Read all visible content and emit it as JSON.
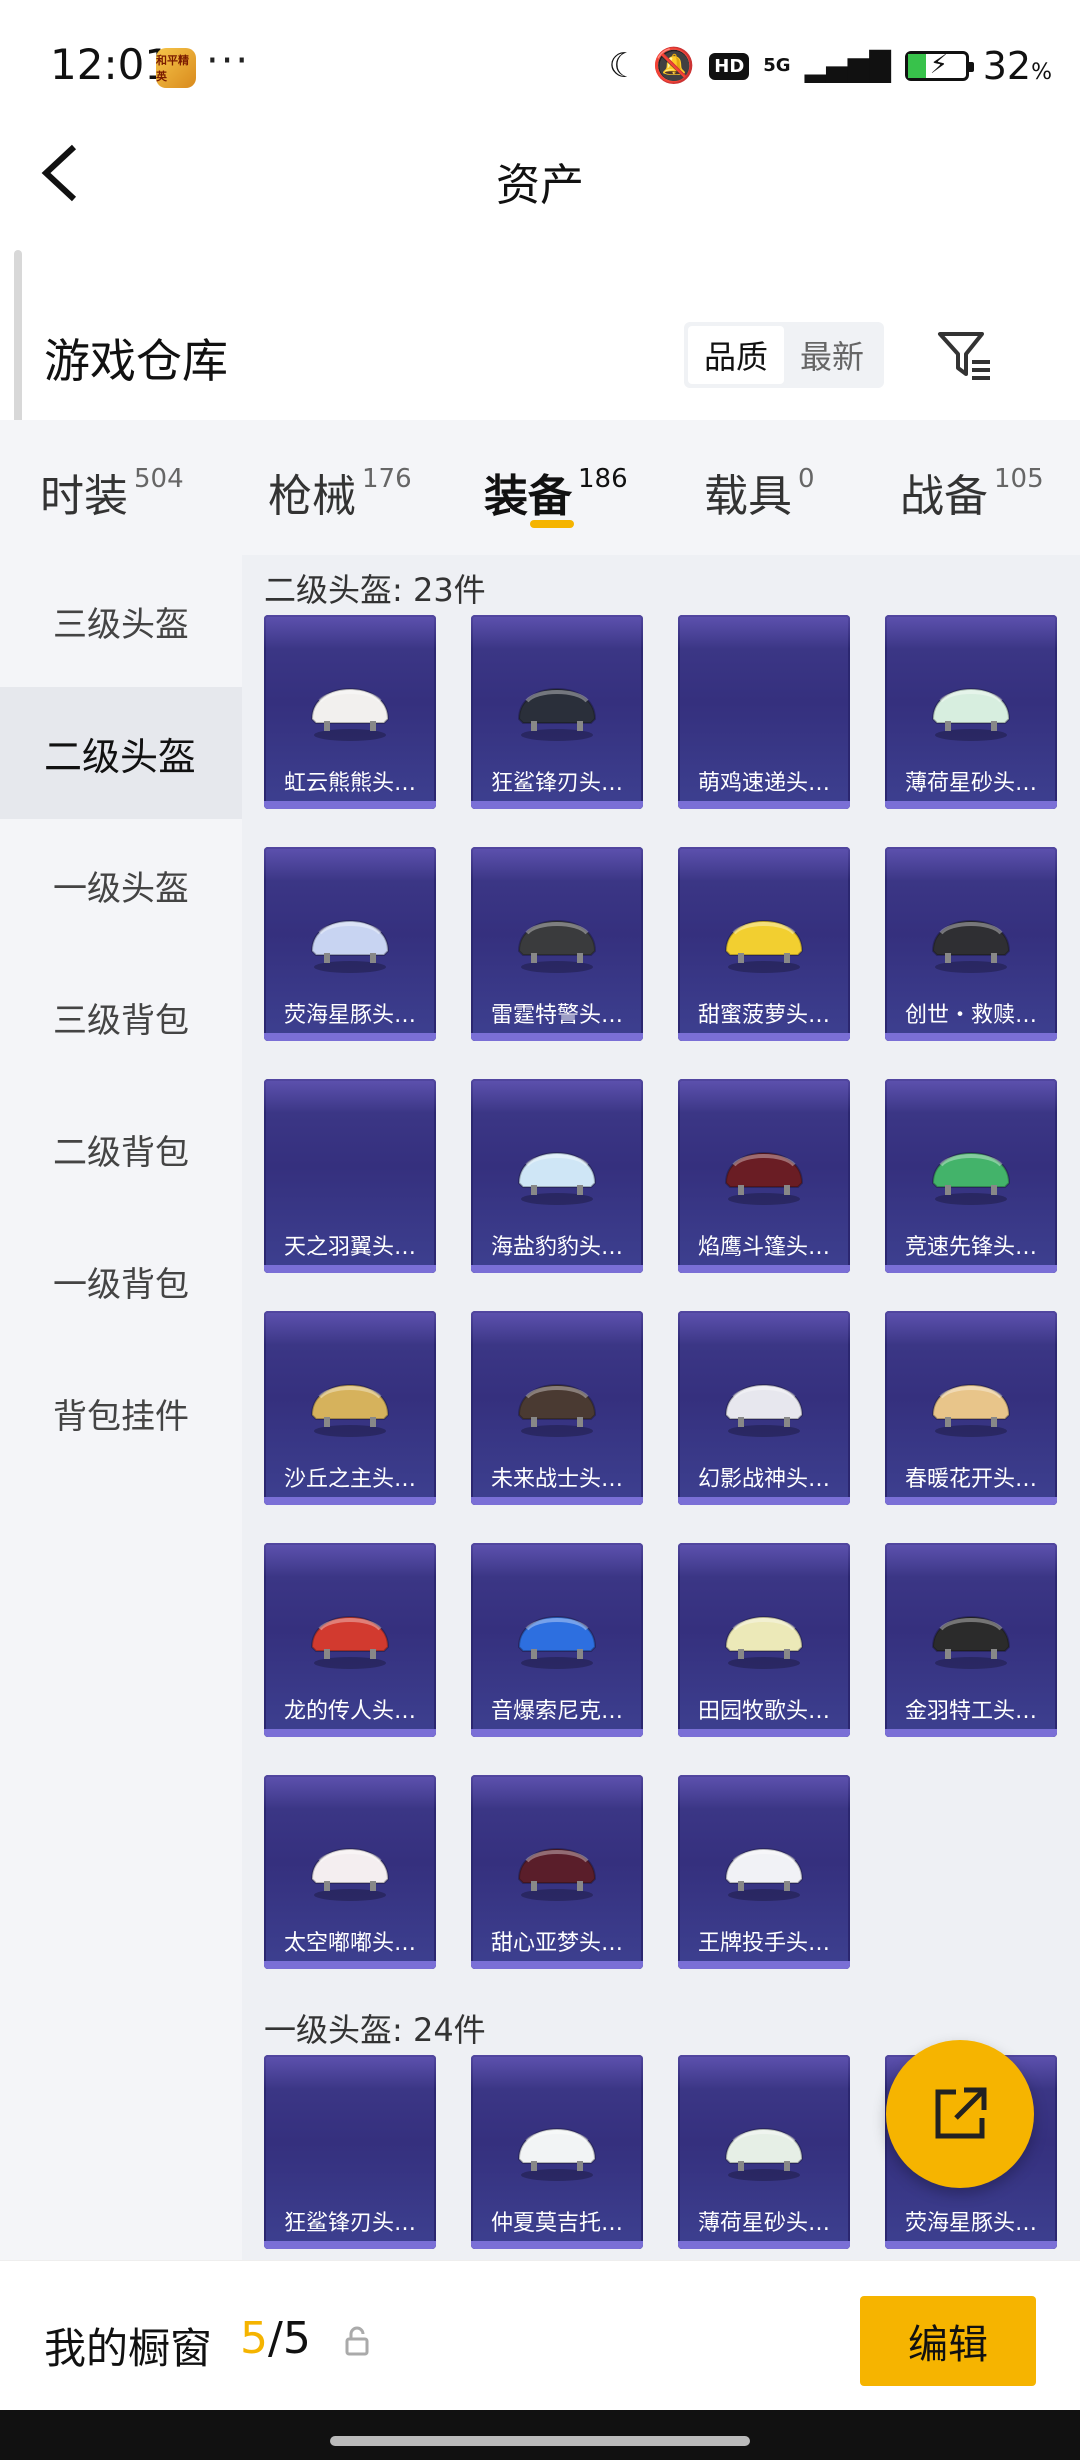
{
  "status": {
    "time": "12:01",
    "app_badge": "和平精英",
    "dots": "···",
    "hd": "HD",
    "net": "5G",
    "battery_pct": "32",
    "battery_unit": "%"
  },
  "header": {
    "title": "资产",
    "back_icon": "chevron-left-icon"
  },
  "warehouse": {
    "title": "游戏仓库",
    "sort_options": [
      "品质",
      "最新"
    ],
    "sort_selected": "品质",
    "filter_icon": "filter-icon"
  },
  "tabs": [
    {
      "label": "时装",
      "count": "504"
    },
    {
      "label": "枪械",
      "count": "176"
    },
    {
      "label": "装备",
      "count": "186"
    },
    {
      "label": "载具",
      "count": "0"
    },
    {
      "label": "战备",
      "count": "105"
    }
  ],
  "active_tab": "装备",
  "leftnav": [
    "三级头盔",
    "二级头盔",
    "一级头盔",
    "三级背包",
    "二级背包",
    "一级背包",
    "背包挂件"
  ],
  "leftnav_active": "二级头盔",
  "groups": [
    {
      "title": "二级头盔: 23件",
      "items": [
        {
          "name": "虹云熊熊头…",
          "color": "#f2f0ee"
        },
        {
          "name": "狂鲨锋刃头…",
          "color": "#2a2f3a"
        },
        {
          "name": "萌鸡速递头…",
          "color": ""
        },
        {
          "name": "薄荷星砂头…",
          "color": "#d7eedf"
        },
        {
          "name": "荧海星豚头…",
          "color": "#c8d4f2"
        },
        {
          "name": "雷霆特警头…",
          "color": "#3a3b3d"
        },
        {
          "name": "甜蜜菠萝头…",
          "color": "#f2cf30"
        },
        {
          "name": "创世・救赎…",
          "color": "#2f2f33"
        },
        {
          "name": "天之羽翼头…",
          "color": ""
        },
        {
          "name": "海盐豹豹头…",
          "color": "#cfe6f6"
        },
        {
          "name": "焰鹰斗篷头…",
          "color": "#6a1d24"
        },
        {
          "name": "竞速先锋头…",
          "color": "#43b36a"
        },
        {
          "name": "沙丘之主头…",
          "color": "#d6b25c"
        },
        {
          "name": "未来战士头…",
          "color": "#4a3a32"
        },
        {
          "name": "幻影战神头…",
          "color": "#e7e7ee"
        },
        {
          "name": "春暖花开头…",
          "color": "#e8c58a"
        },
        {
          "name": "龙的传人头…",
          "color": "#d23a2f"
        },
        {
          "name": "音爆索尼克…",
          "color": "#2d6fe0"
        },
        {
          "name": "田园牧歌头…",
          "color": "#ece9b8"
        },
        {
          "name": "金羽特工头…",
          "color": "#2b2b2b"
        },
        {
          "name": "太空嘟嘟头…",
          "color": "#f4eef0"
        },
        {
          "name": "甜心亚梦头…",
          "color": "#5a1e2a"
        },
        {
          "name": "王牌投手头…",
          "color": "#f1f2f6"
        }
      ]
    },
    {
      "title": "一级头盔: 24件",
      "items": [
        {
          "name": "狂鲨锋刃头…",
          "color": ""
        },
        {
          "name": "仲夏莫吉托…",
          "color": "#f2f4f5"
        },
        {
          "name": "薄荷星砂头…",
          "color": "#e6efe6"
        },
        {
          "name": "荧海星豚头…",
          "color": ""
        }
      ]
    }
  ],
  "bottom": {
    "showcase_label": "我的橱窗",
    "current": "5",
    "total": "/5",
    "edit_label": "编辑",
    "lock_icon": "lock-icon"
  },
  "fab": {
    "icon": "share-external-icon",
    "color": "#f6b400"
  }
}
